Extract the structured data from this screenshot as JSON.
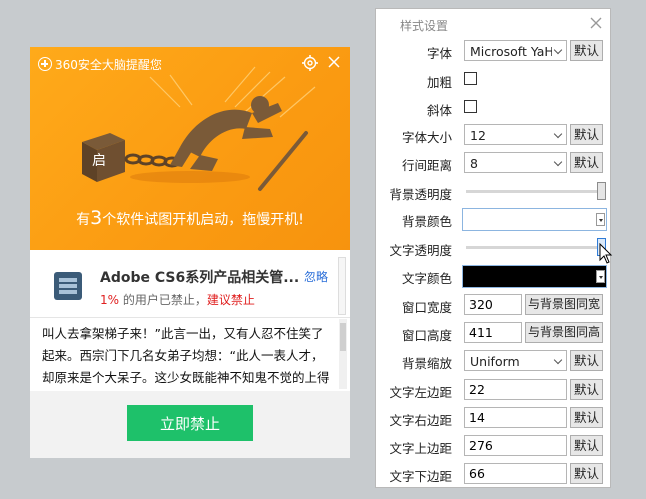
{
  "popup": {
    "brand": "360安全大脑提醒您",
    "illustration_badge": "启",
    "message_prefix": "有",
    "message_count": "3",
    "message_suffix": "个软件试图开机启动，拖慢开机!",
    "app": {
      "name": "Adobe CS6系列产品相关管...",
      "ignore_label": "忽略",
      "percent": "1%",
      "stat_text": " 的用户已禁止，",
      "advice": "建议禁止"
    },
    "body_text": "叫人去拿架梯子来！”此言一出，又有人忍不住笑了起来。西宗门下几名女弟子均想：“此人一表人才，却原来是个大呆子。这少女既能神不知鬼不觉的上得",
    "ban_button": "立即禁止"
  },
  "panel": {
    "title": "样式设置",
    "default_label": "默认",
    "fields": {
      "font": {
        "label": "字体",
        "value": "Microsoft YaH"
      },
      "bold": {
        "label": "加粗",
        "checked": false
      },
      "italic": {
        "label": "斜体",
        "checked": false
      },
      "font_size": {
        "label": "字体大小",
        "value": "12"
      },
      "line_spacing": {
        "label": "行间距离",
        "value": "8"
      },
      "bg_opacity": {
        "label": "背景透明度",
        "level": 1.0
      },
      "bg_color": {
        "label": "背景颜色",
        "color": "#ffffff"
      },
      "text_opacity": {
        "label": "文字透明度",
        "level": 1.0
      },
      "text_color": {
        "label": "文字颜色",
        "color": "#000000"
      },
      "win_width": {
        "label": "窗口宽度",
        "value": "320",
        "button": "与背景图同宽"
      },
      "win_height": {
        "label": "窗口高度",
        "value": "411",
        "button": "与背景图同高"
      },
      "bg_scale": {
        "label": "背景缩放",
        "value": "Uniform"
      },
      "margin_left": {
        "label": "文字左边距",
        "value": "22"
      },
      "margin_right": {
        "label": "文字右边距",
        "value": "14"
      },
      "margin_top": {
        "label": "文字上边距",
        "value": "276"
      },
      "margin_bottom": {
        "label": "文字下边距",
        "value": "66"
      }
    }
  },
  "colors": {
    "header_orange": "#fb9c12",
    "ban_green": "#1ec16a",
    "link_blue": "#2a6ed8",
    "warning_red": "#e02020"
  }
}
